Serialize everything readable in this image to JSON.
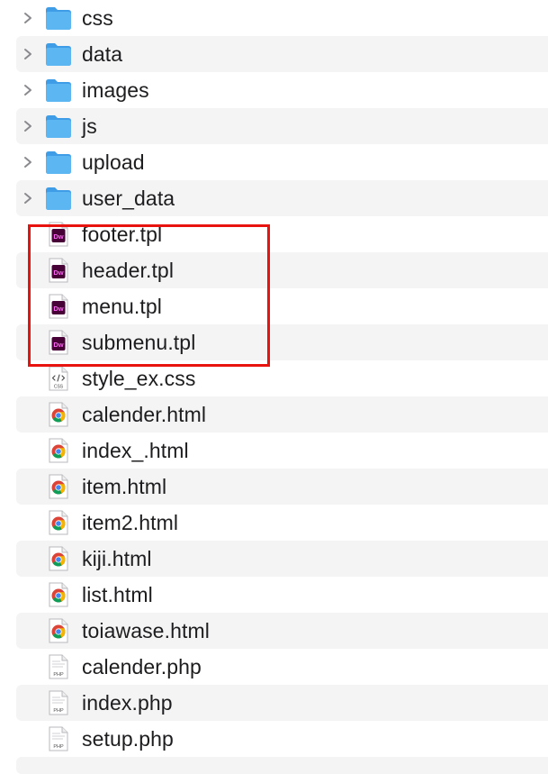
{
  "files": [
    {
      "name": "css",
      "kind": "folder"
    },
    {
      "name": "data",
      "kind": "folder"
    },
    {
      "name": "images",
      "kind": "folder"
    },
    {
      "name": "js",
      "kind": "folder"
    },
    {
      "name": "upload",
      "kind": "folder"
    },
    {
      "name": "user_data",
      "kind": "folder"
    },
    {
      "name": "footer.tpl",
      "kind": "dreamweaver-file",
      "icon_text": "Dw"
    },
    {
      "name": "header.tpl",
      "kind": "dreamweaver-file",
      "icon_text": "Dw"
    },
    {
      "name": "menu.tpl",
      "kind": "dreamweaver-file",
      "icon_text": "Dw"
    },
    {
      "name": "submenu.tpl",
      "kind": "dreamweaver-file",
      "icon_text": "Dw"
    },
    {
      "name": "style_ex.css",
      "kind": "css-file",
      "icon_text": "CSS"
    },
    {
      "name": "calender.html",
      "kind": "chrome-html-file"
    },
    {
      "name": "index_.html",
      "kind": "chrome-html-file"
    },
    {
      "name": "item.html",
      "kind": "chrome-html-file"
    },
    {
      "name": "item2.html",
      "kind": "chrome-html-file"
    },
    {
      "name": "kiji.html",
      "kind": "chrome-html-file"
    },
    {
      "name": "list.html",
      "kind": "chrome-html-file"
    },
    {
      "name": "toiawase.html",
      "kind": "chrome-html-file"
    },
    {
      "name": "calender.php",
      "kind": "php-file",
      "icon_text": "PHP"
    },
    {
      "name": "index.php",
      "kind": "php-file",
      "icon_text": "PHP"
    },
    {
      "name": "setup.php",
      "kind": "php-file",
      "icon_text": "PHP"
    }
  ],
  "highlight": {
    "color": "#e8120f",
    "covers": [
      "footer.tpl",
      "header.tpl",
      "menu.tpl",
      "submenu.tpl"
    ]
  },
  "colors": {
    "folder": "#5bb6f2",
    "dreamweaver": "#470137",
    "dreamweaver_text": "#ff61f6",
    "row_alt": "#f4f4f5"
  }
}
